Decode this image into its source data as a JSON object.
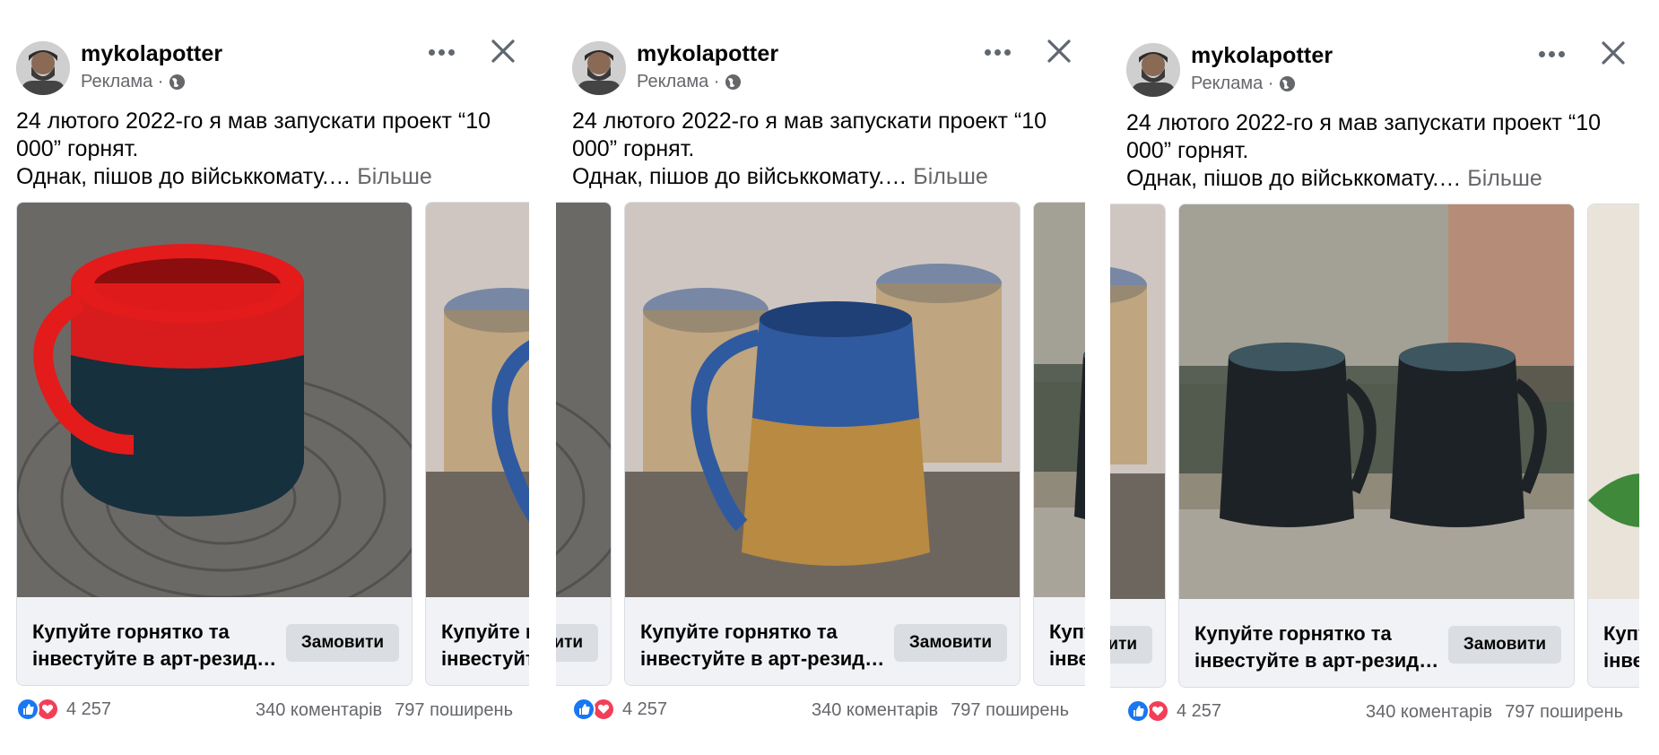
{
  "post": {
    "author": "mykolapotter",
    "sponsored": "Реклама ·",
    "text_lines": [
      "24 лютого 2022-го я мав запускати проект “10",
      "000” горнят.",
      "Однак, пішов до військкомату.…"
    ],
    "see_more": "Більше",
    "card_title_line1": "Купуйте горнятко та",
    "card_title_line2": "інвестуйте в арт-резид…",
    "card_button": "Замовити",
    "reactions_count": "4 257",
    "comments": "340 коментарів",
    "shares": "797 поширень"
  },
  "icons": [
    "avatar",
    "globe-icon",
    "more-icon",
    "close-icon",
    "like-icon",
    "love-icon"
  ],
  "colors": {
    "text": "#050505",
    "muted": "#65676b",
    "card_bg": "#f0f2f5",
    "button_bg": "#dadde1",
    "like": "#1877f2",
    "love": "#f33e58"
  }
}
